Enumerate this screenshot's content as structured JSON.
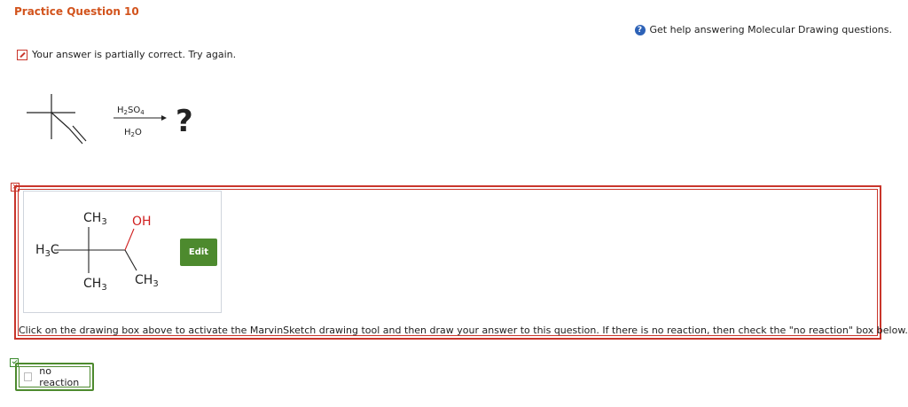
{
  "question": {
    "title": "Practice Question 10",
    "help_link": "Get help answering Molecular Drawing questions.",
    "status": "Your answer is partially correct.  Try again."
  },
  "reaction": {
    "reagent_top": "H2SO4",
    "reagent_bottom": "H2O",
    "product": "?"
  },
  "answer": {
    "edit_label": "Edit",
    "instructions": "Click on the drawing box above to activate the MarvinSketch drawing tool and then draw your answer to this question. If there is no reaction, then check the \"no reaction\" box below.",
    "molecule_labels": {
      "ch3_top": "CH3",
      "oh": "OH",
      "h3c": "H3C",
      "ch3_bottom": "CH3",
      "ch3_right": "CH3"
    }
  },
  "no_reaction": {
    "label": "no reaction",
    "checked": false
  },
  "colors": {
    "title": "#d2531c",
    "wrong": "#c9352b",
    "correct": "#4d8a2e",
    "help_icon": "#2d62b7",
    "oh_label": "#d02020"
  }
}
